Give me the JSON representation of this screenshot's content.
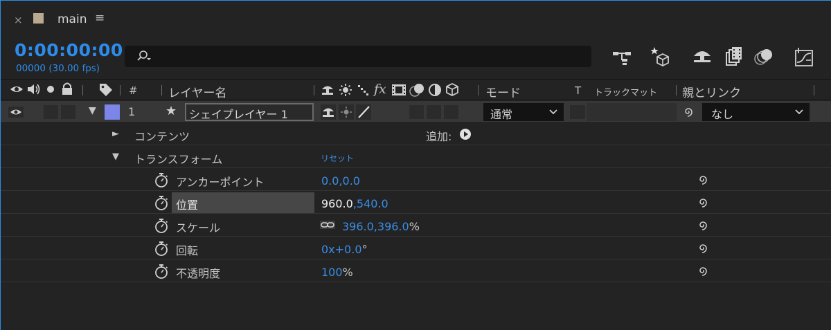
{
  "tab": {
    "close_glyph": "×",
    "title": "main",
    "menu_glyph": "≡",
    "swatch_color": "#b9a98f"
  },
  "toolbar": {
    "timecode": "0:00:00:00",
    "frames": "00000 (30.00 fps)",
    "search_value": "",
    "tools": [
      "comp-flowchart-icon",
      "draft-3d-icon",
      "shy-layers-icon",
      "frame-blending-icon",
      "motion-blur-icon",
      "graph-editor-icon"
    ]
  },
  "columns": {
    "num": "#",
    "layer_name": "レイヤー名",
    "fx": "fx",
    "mode": "モード",
    "t": "T",
    "track_matte": "トラックマット",
    "parent_link": "親とリンク"
  },
  "layer": {
    "number": "1",
    "star": "★",
    "name": "シェイプレイヤー 1",
    "label_color": "#7b86e8",
    "mode": "通常",
    "parent": "なし"
  },
  "properties": {
    "contents": "コンテンツ",
    "add_label": "追加:",
    "transform": "トランスフォーム",
    "reset": "リセット",
    "anchor_label": "アンカーポイント",
    "anchor_value": "0.0,0.0",
    "position_label": "位置",
    "position_x": "960.0",
    "position_comma": ",",
    "position_y": "540.0",
    "scale_label": "スケール",
    "scale_value": "396.0,396.0",
    "scale_unit": "%",
    "rotation_label": "回転",
    "rotation_value": "0x+0.0",
    "rotation_unit": "°",
    "opacity_label": "不透明度",
    "opacity_value": "100",
    "opacity_unit": "%"
  },
  "glyphs": {
    "tri_right": "►",
    "tri_down": "▼"
  }
}
